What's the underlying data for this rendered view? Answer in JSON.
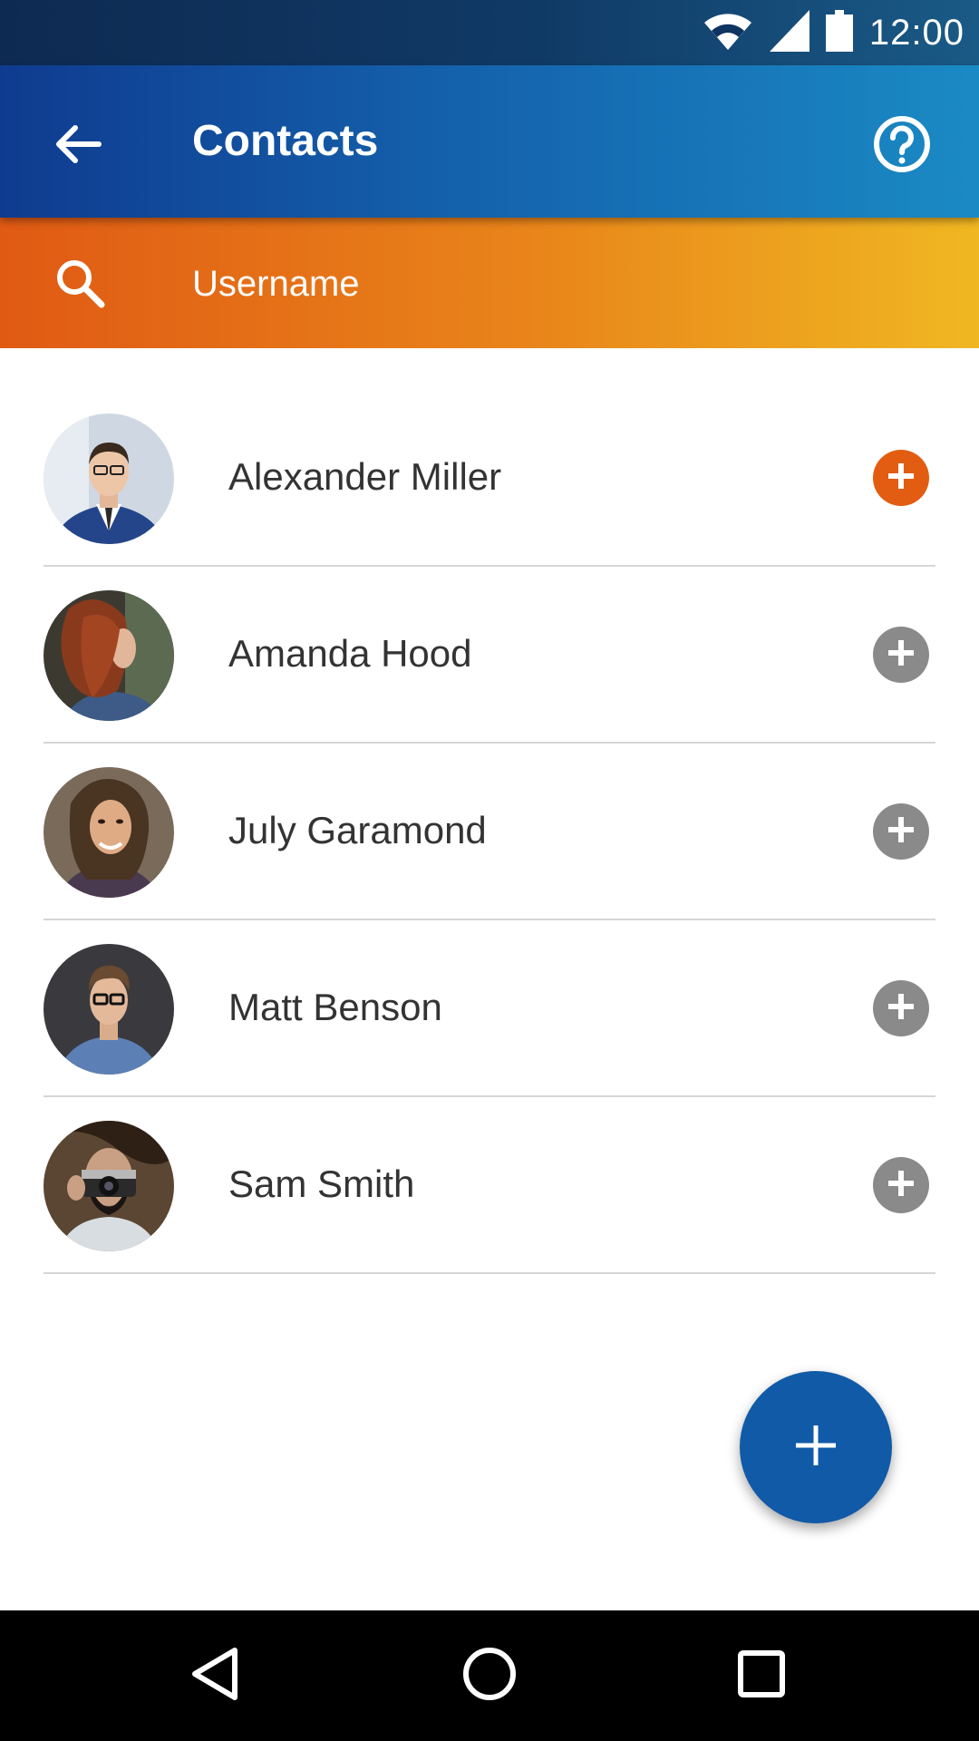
{
  "status_bar": {
    "time": "12:00",
    "icons": [
      "wifi-icon",
      "signal-icon",
      "battery-icon"
    ]
  },
  "app_bar": {
    "title": "Contacts",
    "back_icon": "arrow-left-icon",
    "help_icon": "help-circle-icon"
  },
  "search": {
    "placeholder": "Username",
    "value": "",
    "icon": "search-icon"
  },
  "contacts": [
    {
      "name": "Alexander Miller",
      "added": true
    },
    {
      "name": "Amanda Hood",
      "added": false
    },
    {
      "name": "July Garamond",
      "added": false
    },
    {
      "name": "Matt Benson",
      "added": false
    },
    {
      "name": "Sam Smith",
      "added": false
    }
  ],
  "fab": {
    "icon": "plus-icon"
  },
  "nav_bar": {
    "buttons": [
      "back-triangle-icon",
      "home-circle-icon",
      "recents-square-icon"
    ]
  },
  "colors": {
    "primary": "#115aa8",
    "accent": "#e25d12",
    "inactive": "#8a8a8a",
    "divider": "#d6d6d6"
  }
}
